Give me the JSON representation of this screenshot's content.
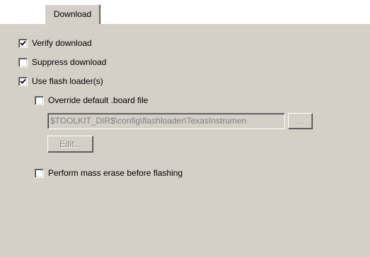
{
  "tabs": [
    {
      "label": "Download",
      "active": true
    }
  ],
  "options": {
    "verify_download": {
      "label": "Verify download",
      "checked": true
    },
    "suppress_download": {
      "label": "Suppress download",
      "checked": false
    },
    "use_flash_loader": {
      "label": "Use flash loader(s)",
      "checked": true
    },
    "override_board_file": {
      "label": "Override default .board file",
      "checked": false
    },
    "mass_erase": {
      "label": "Perform mass erase before flashing",
      "checked": false
    }
  },
  "board_file": {
    "value": "$TOOLKIT_DIR$\\config\\flashloader\\TexasInstrumen",
    "browse_label": "...",
    "edit_label": "Edit..."
  }
}
